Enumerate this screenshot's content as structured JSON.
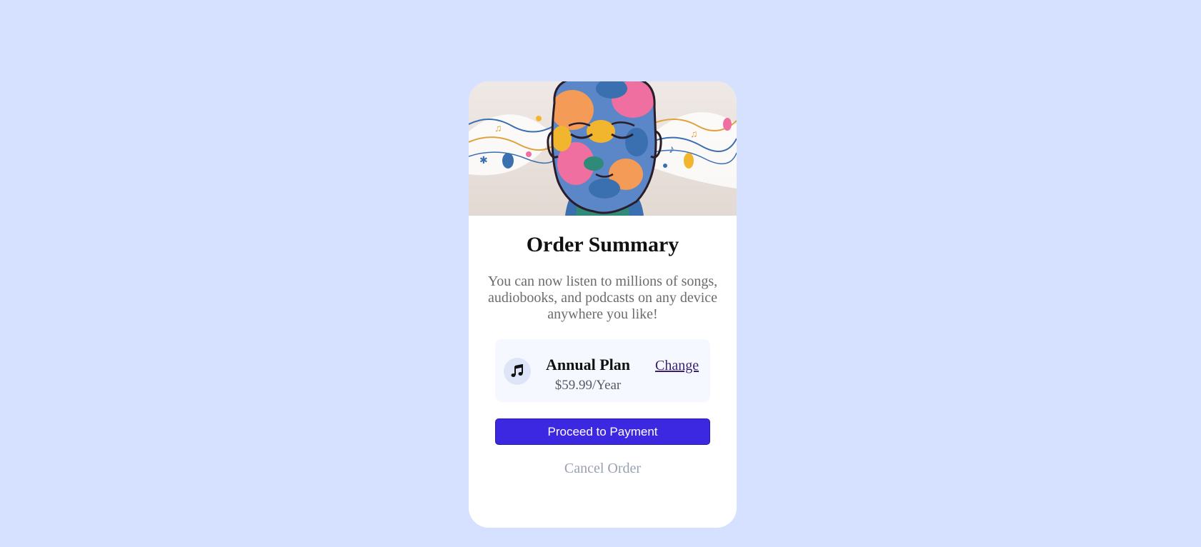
{
  "card": {
    "title": "Order Summary",
    "description": "You can now listen to millions of songs, audiobooks, and podcasts on any device anywhere you like!",
    "hero_icon": "illustration-hero-image"
  },
  "plan": {
    "icon": "music-note-icon",
    "name": "Annual Plan",
    "price": "$59.99/Year",
    "change_label": "Change"
  },
  "actions": {
    "proceed_label": "Proceed to Payment",
    "cancel_label": "Cancel Order"
  },
  "colors": {
    "page_background": "#d6e0ff",
    "card_background": "#ffffff",
    "primary_button": "#3b28e0",
    "plan_box_background": "#f6f8ff",
    "muted_text": "#9aa0b3"
  }
}
